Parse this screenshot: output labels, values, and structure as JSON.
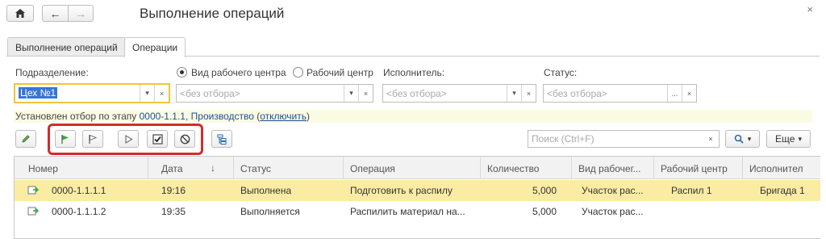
{
  "window": {
    "title": "Выполнение операций",
    "close_glyph": "×",
    "nav": {
      "home_icon": "home-icon",
      "back_glyph": "←",
      "forward_glyph": "→"
    }
  },
  "tabs": [
    {
      "label": "Выполнение операций",
      "active": false
    },
    {
      "label": "Операции",
      "active": true
    }
  ],
  "filters": {
    "subdivision_label": "Подразделение:",
    "subdivision_value": "Цех №1",
    "radio_work_center_type": "Вид рабочего центра",
    "radio_work_center": "Рабочий центр",
    "radio_selected": "Вид рабочего центра",
    "work_center_placeholder": "<без отбора>",
    "executor_label": "Исполнитель:",
    "executor_placeholder": "<без отбора>",
    "status_label": "Статус:",
    "status_placeholder": "<без отбора>",
    "dots": "...",
    "clear_glyph": "×",
    "dropdown_glyph": "▾"
  },
  "filter_notice": {
    "prefix": "Установлен отбор по этапу ",
    "link": "0000-1.1.1, Производство",
    "open_paren": " (",
    "action": "отключить",
    "close_paren": ")"
  },
  "toolbar": {
    "search_placeholder": "Поиск (Ctrl+F)",
    "more_label": "Еще",
    "accent_highlight": "#d62a2a"
  },
  "table": {
    "columns": [
      "Номер",
      "Дата",
      "Статус",
      "Операция",
      "Количество",
      "Вид рабочег...",
      "Рабочий центр",
      "Исполнител"
    ],
    "sort_glyph": "↓",
    "rows": [
      {
        "number": "0000-1.1.1.1",
        "date": "19:16",
        "status": "Выполнена",
        "operation": "Подготовить к распилу",
        "qty": "5,000",
        "wc_type": "Участок рас...",
        "work_center": "Распил 1",
        "executor": "Бригада 1",
        "selected": true
      },
      {
        "number": "0000-1.1.1.2",
        "date": "19:35",
        "status": "Выполняется",
        "operation": "Распилить материал на...",
        "qty": "5,000",
        "wc_type": "Участок рас...",
        "work_center": "",
        "executor": "",
        "selected": false
      }
    ]
  }
}
